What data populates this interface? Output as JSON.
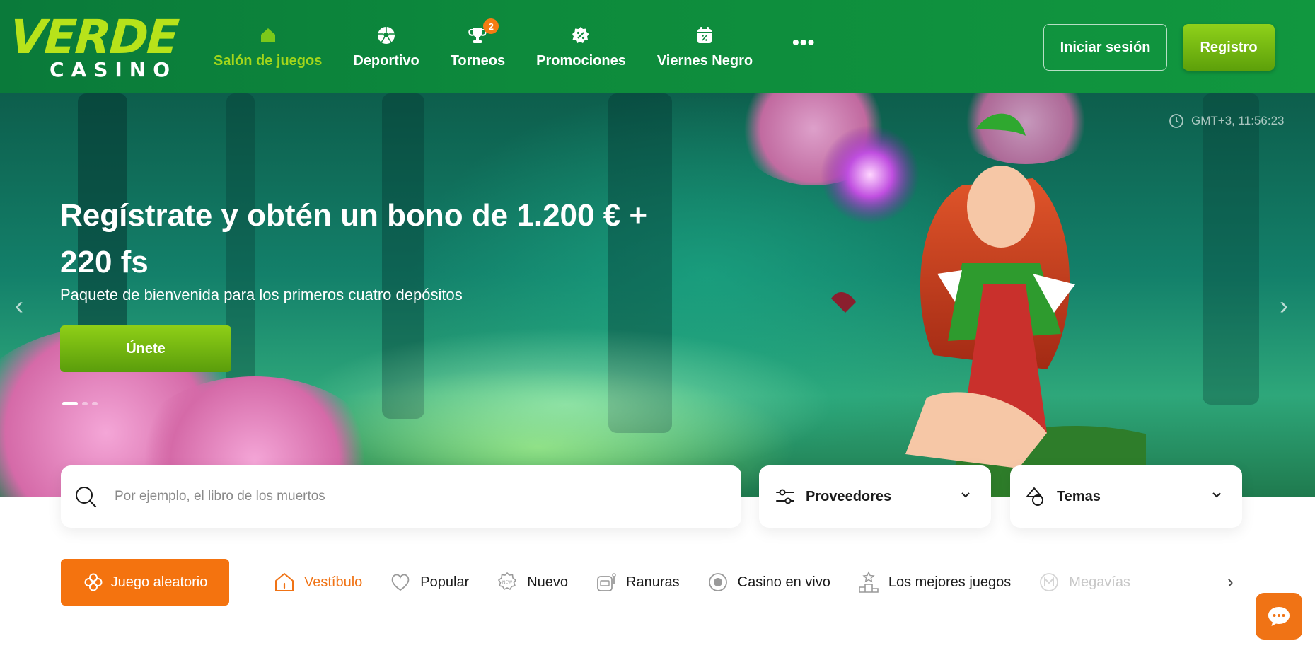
{
  "brand": {
    "logo_top": "VERDE",
    "logo_bottom": "CASINO",
    "color_green": "#b7e31a"
  },
  "nav": {
    "items": [
      {
        "label": "Salón de juegos",
        "icon": "home-icon",
        "active": true
      },
      {
        "label": "Deportivo",
        "icon": "soccer-ball-icon"
      },
      {
        "label": "Torneos",
        "icon": "trophy-icon",
        "badge": "2"
      },
      {
        "label": "Promociones",
        "icon": "percent-badge-icon"
      },
      {
        "label": "Viernes Negro",
        "icon": "calendar-percent-icon"
      }
    ],
    "more": "•••"
  },
  "auth": {
    "login_label": "Iniciar sesión",
    "register_label": "Registro"
  },
  "hero": {
    "clock": "GMT+3, 11:56:23",
    "title": "Regístrate y obtén un bono de 1.200 € + 220 fs",
    "subtitle": "Paquete de bienvenida para los primeros cuatro depósitos",
    "cta": "Únete",
    "slide_count": 3,
    "active_slide": 1
  },
  "search": {
    "placeholder": "Por ejemplo, el libro de los muertos",
    "value": ""
  },
  "filters": {
    "providers_label": "Proveedores",
    "themes_label": "Temas"
  },
  "categories": {
    "random_label": "Juego aleatorio",
    "items": [
      {
        "label": "Vestíbulo",
        "icon": "lobby-house-icon",
        "active": true
      },
      {
        "label": "Popular",
        "icon": "heart-icon"
      },
      {
        "label": "Nuevo",
        "icon": "new-badge-icon"
      },
      {
        "label": "Ranuras",
        "icon": "slot-machine-icon"
      },
      {
        "label": "Casino en vivo",
        "icon": "live-record-icon"
      },
      {
        "label": "Los mejores juegos",
        "icon": "podium-star-icon"
      },
      {
        "label": "Megavías",
        "icon": "megaways-icon"
      }
    ]
  },
  "colors": {
    "accent_orange": "#f4730f",
    "header_green": "#0d8a3c",
    "cta_green": "#6fb010"
  }
}
